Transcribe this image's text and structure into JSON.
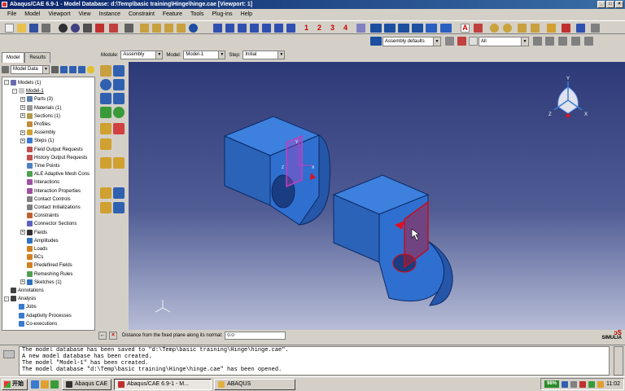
{
  "window": {
    "title": "Abaqus/CAE 6.9-1 - Model Database: d:\\Temp\\basic training\\Hinge\\hinge.cae [Viewport: 1]"
  },
  "menu": [
    "File",
    "Model",
    "Viewport",
    "View",
    "Instance",
    "Constraint",
    "Feature",
    "Tools",
    "Plug-ins",
    "Help"
  ],
  "toolbar": {
    "numbers": [
      "1",
      "2",
      "3",
      "4"
    ],
    "render_style": "Assembly defaults",
    "display_group": "All"
  },
  "context": {
    "module_label": "Module:",
    "module_value": "Assembly",
    "model_label": "Model:",
    "model_value": "Model-1",
    "step_label": "Step:",
    "step_value": "Initial"
  },
  "tabs": [
    "Model",
    "Results"
  ],
  "tree_combo": "Model Data",
  "tree": [
    {
      "label": "Models (1)",
      "indent": 0,
      "exp": "-",
      "icon": "models-icon",
      "color": "#6b6bb0"
    },
    {
      "label": "Model-1",
      "indent": 1,
      "exp": "-",
      "icon": "model-icon",
      "color": "#c8c8c8",
      "underline": true
    },
    {
      "label": "Parts (3)",
      "indent": 2,
      "exp": "+",
      "icon": "parts-icon",
      "color": "#5e7fa8"
    },
    {
      "label": "Materials (1)",
      "indent": 2,
      "exp": "+",
      "icon": "materials-icon",
      "color": "#9a9a9a"
    },
    {
      "label": "Sections (1)",
      "indent": 2,
      "exp": "+",
      "icon": "sections-icon",
      "color": "#b59a4a"
    },
    {
      "label": "Profiles",
      "indent": 2,
      "exp": "",
      "icon": "profiles-icon",
      "color": "#c48a3a"
    },
    {
      "label": "Assembly",
      "indent": 2,
      "exp": "+",
      "icon": "assembly-icon",
      "color": "#d0a030"
    },
    {
      "label": "Steps (1)",
      "indent": 2,
      "exp": "+",
      "icon": "steps-icon",
      "color": "#3a7ad0"
    },
    {
      "label": "Field Output Requests",
      "indent": 2,
      "exp": "",
      "icon": "field-output-icon",
      "color": "#c05050"
    },
    {
      "label": "History Output Requests",
      "indent": 2,
      "exp": "",
      "icon": "history-output-icon",
      "color": "#c05050"
    },
    {
      "label": "Time Points",
      "indent": 2,
      "exp": "",
      "icon": "time-points-icon",
      "color": "#5080c0"
    },
    {
      "label": "ALE Adaptive Mesh Cons",
      "indent": 2,
      "exp": "",
      "icon": "ale-mesh-icon",
      "color": "#50a050"
    },
    {
      "label": "Interactions",
      "indent": 2,
      "exp": "",
      "icon": "interactions-icon",
      "color": "#a050a0"
    },
    {
      "label": "Interaction Properties",
      "indent": 2,
      "exp": "",
      "icon": "interaction-properties-icon",
      "color": "#a050a0"
    },
    {
      "label": "Contact Controls",
      "indent": 2,
      "exp": "",
      "icon": "contact-controls-icon",
      "color": "#808080"
    },
    {
      "label": "Contact Initializations",
      "indent": 2,
      "exp": "",
      "icon": "contact-init-icon",
      "color": "#808080"
    },
    {
      "label": "Constraints",
      "indent": 2,
      "exp": "",
      "icon": "constraints-icon",
      "color": "#c06030"
    },
    {
      "label": "Connector Sections",
      "indent": 2,
      "exp": "",
      "icon": "connector-sections-icon",
      "color": "#6060c0"
    },
    {
      "label": "Fields",
      "indent": 2,
      "exp": "+",
      "icon": "fields-icon",
      "color": "#303030"
    },
    {
      "label": "Amplitudes",
      "indent": 2,
      "exp": "",
      "icon": "amplitudes-icon",
      "color": "#3070c0"
    },
    {
      "label": "Loads",
      "indent": 2,
      "exp": "",
      "icon": "loads-icon",
      "color": "#d08020"
    },
    {
      "label": "BCs",
      "indent": 2,
      "exp": "",
      "icon": "bcs-icon",
      "color": "#d08020"
    },
    {
      "label": "Predefined Fields",
      "indent": 2,
      "exp": "",
      "icon": "predefined-fields-icon",
      "color": "#d08020"
    },
    {
      "label": "Remeshing Rules",
      "indent": 2,
      "exp": "",
      "icon": "remeshing-icon",
      "color": "#50a050"
    },
    {
      "label": "Sketches (1)",
      "indent": 2,
      "exp": "+",
      "icon": "sketches-icon",
      "color": "#3070c0"
    },
    {
      "label": "Annotations",
      "indent": 0,
      "exp": "",
      "icon": "annotations-icon",
      "color": "#404040"
    },
    {
      "label": "Analysis",
      "indent": 0,
      "exp": "-",
      "icon": "analysis-icon",
      "color": "#404040"
    },
    {
      "label": "Jobs",
      "indent": 1,
      "exp": "",
      "icon": "jobs-icon",
      "color": "#3a7ad0"
    },
    {
      "label": "Adaptivity Processes",
      "indent": 1,
      "exp": "",
      "icon": "adaptivity-icon",
      "color": "#3a7ad0"
    },
    {
      "label": "Co-executions",
      "indent": 1,
      "exp": "",
      "icon": "co-executions-icon",
      "color": "#3a7ad0"
    }
  ],
  "prompt": {
    "text": "Distance from the fixed plane along its normal:",
    "value": "0.0",
    "brand": "SIMULIA"
  },
  "messages": [
    "The model database has been saved to \"d:\\Temp\\basic training\\Hinge\\hinge.cae\".",
    "A new model database has been created.",
    "The model \"Model-1\" has been created.",
    "The model database \"d:\\Temp\\basic training\\Hinge\\hinge.cae\" has been opened."
  ],
  "triad": {
    "x": "X",
    "y": "Y",
    "z": "Z"
  },
  "taskbar": {
    "start": "开始",
    "tasks": [
      "Abaqus CAE",
      "Abaqus/CAE 6.9-1 - M...",
      "ABAQUS"
    ],
    "battery": "98%",
    "clock": "11:02"
  },
  "colors": {
    "part": "#2f6fd0",
    "plane_magenta": "#c040c0",
    "plane_red": "#c01020",
    "viewport_top": "#2d3a78",
    "viewport_bottom": "#b7bdd7"
  }
}
